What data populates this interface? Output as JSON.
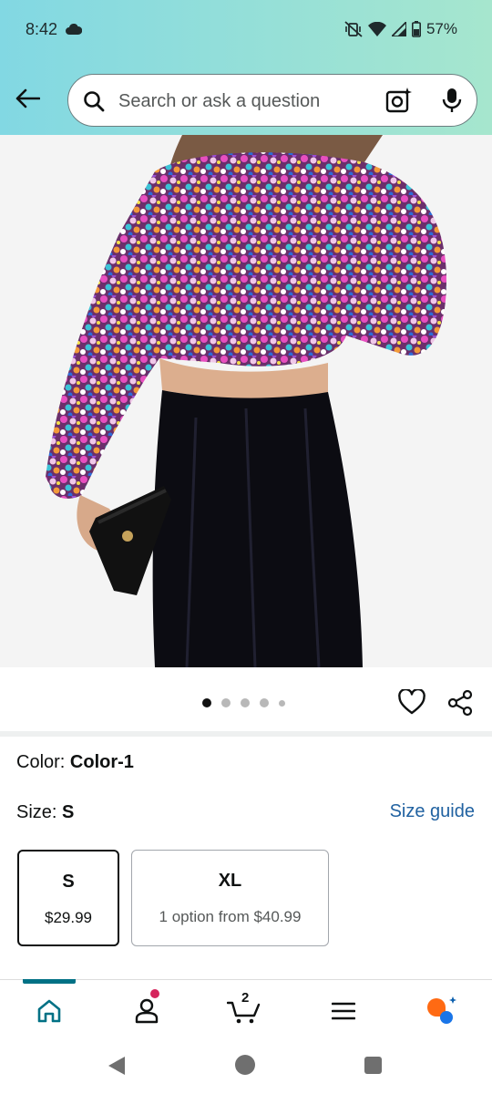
{
  "status_bar": {
    "time": "8:42",
    "battery": "57%"
  },
  "search": {
    "placeholder": "Search or ask a question"
  },
  "gallery": {
    "total_images": 5,
    "current_index": 1
  },
  "product": {
    "color_label": "Color:",
    "color_value": "Color-1",
    "size_label": "Size:",
    "size_value": "S",
    "size_guide_label": "Size guide",
    "size_options": [
      {
        "name": "S",
        "price": "$29.99",
        "selected": true
      },
      {
        "name": "XL",
        "price": "1 option from $40.99",
        "selected": false
      }
    ]
  },
  "bottom_nav": {
    "cart_count": "2",
    "items": [
      "home-icon",
      "account-icon",
      "cart-icon",
      "menu-icon",
      "rufus-icon"
    ]
  },
  "colors": {
    "accent": "#007185",
    "link": "#2162a1",
    "notification": "#d5245c",
    "header_gradient_start": "#82d8e3",
    "header_gradient_end": "#a6e6ce"
  }
}
